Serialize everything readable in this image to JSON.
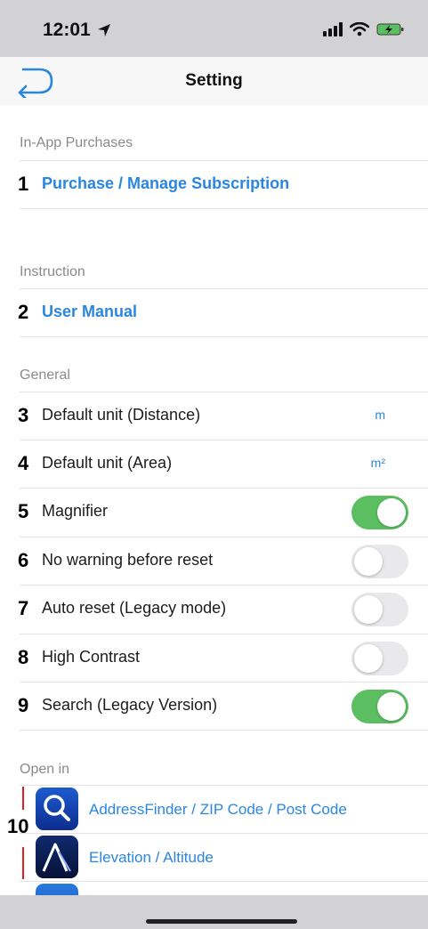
{
  "status_bar": {
    "time": "12:01"
  },
  "nav": {
    "title": "Setting"
  },
  "sections": {
    "purchases": {
      "header": "In-App Purchases"
    },
    "instruction": {
      "header": "Instruction"
    },
    "general": {
      "header": "General"
    },
    "open_in": {
      "header": "Open in"
    }
  },
  "rows": [
    {
      "num": "1",
      "label": "Purchase / Manage Subscription"
    },
    {
      "num": "2",
      "label": "User Manual"
    },
    {
      "num": "3",
      "label": "Default unit (Distance)",
      "value": "m"
    },
    {
      "num": "4",
      "label": "Default unit (Area)",
      "value": "m²"
    },
    {
      "num": "5",
      "label": "Magnifier",
      "toggle": true
    },
    {
      "num": "6",
      "label": "No warning before reset",
      "toggle": false
    },
    {
      "num": "7",
      "label": "Auto reset (Legacy mode)",
      "toggle": false
    },
    {
      "num": "8",
      "label": "High Contrast",
      "toggle": false
    },
    {
      "num": "9",
      "label": "Search (Legacy Version)",
      "toggle": true
    }
  ],
  "open_in": {
    "group_number": "10",
    "apps": [
      {
        "label": "AddressFinder / ZIP Code / Post Code",
        "icon": "magnifier-app-icon"
      },
      {
        "label": "Elevation / Altitude",
        "icon": "mountain-app-icon"
      }
    ]
  },
  "colors": {
    "link": "#2a86e0",
    "toggle_on": "#5bbf62",
    "toggle_off": "#e9e9ec",
    "marker": "#e02020"
  }
}
